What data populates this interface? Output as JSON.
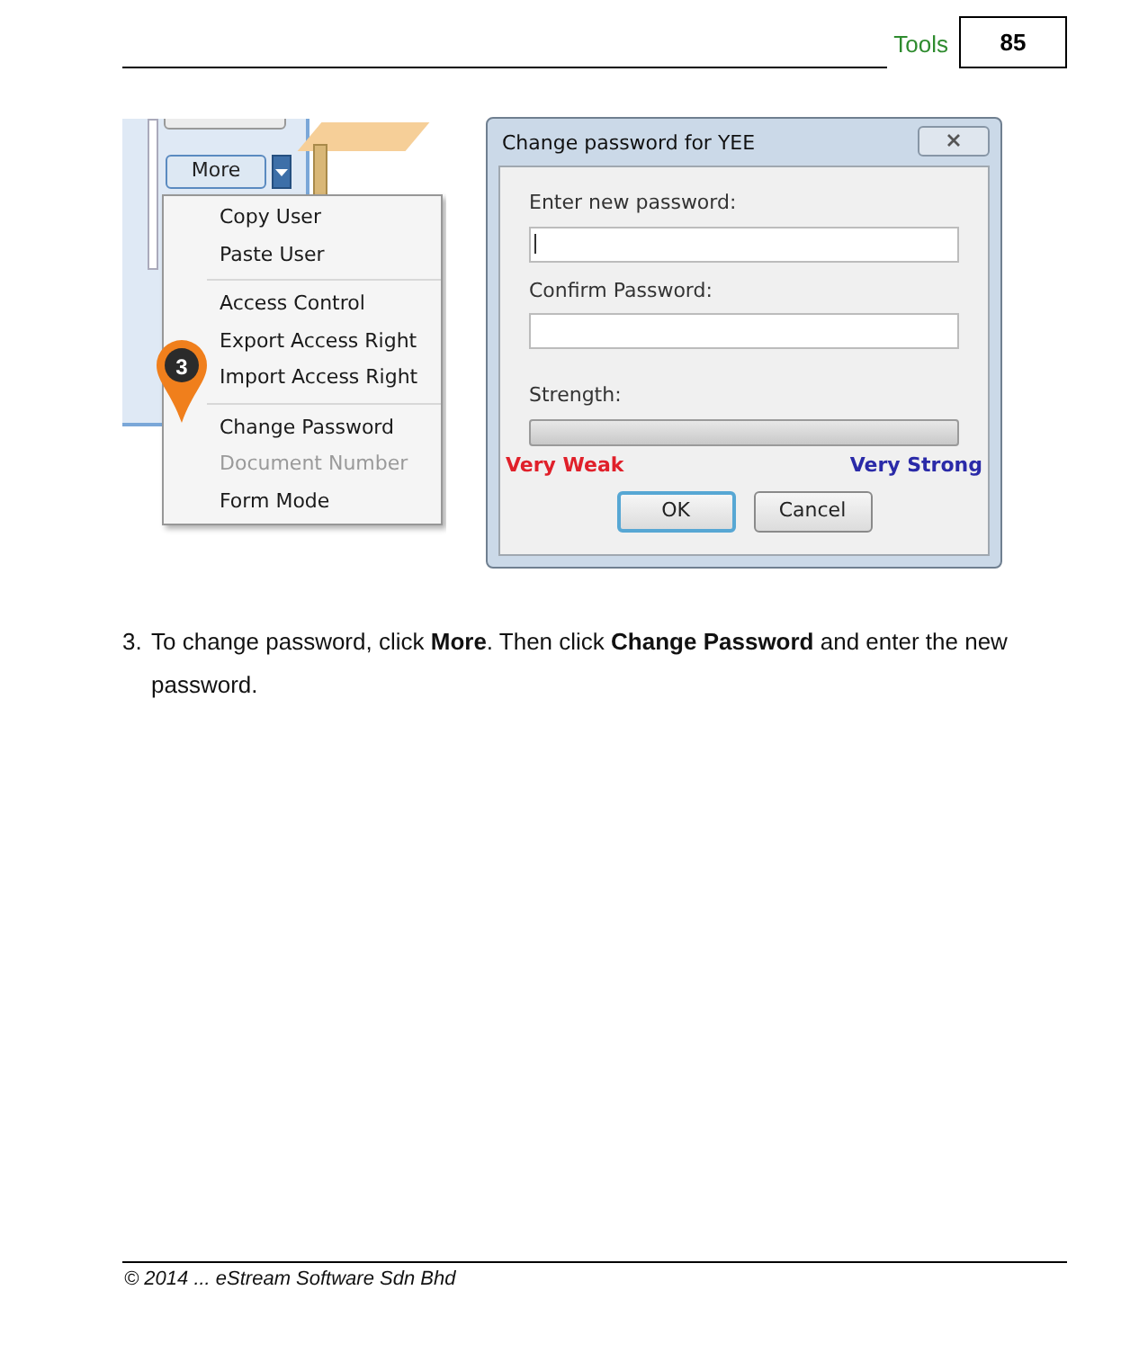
{
  "header": {
    "section": "Tools",
    "page_number": "85"
  },
  "menu_screenshot": {
    "more_button": "More",
    "callout": "3",
    "menu_groups": [
      [
        {
          "label": "Copy User",
          "disabled": false
        },
        {
          "label": "Paste User",
          "disabled": false
        }
      ],
      [
        {
          "label": "Access Control",
          "disabled": false
        },
        {
          "label": "Export Access Right",
          "disabled": false
        },
        {
          "label": "Import Access Right",
          "disabled": false
        }
      ],
      [
        {
          "label": "Change Password",
          "disabled": false
        },
        {
          "label": "Document Number",
          "disabled": true
        },
        {
          "label": "Form Mode",
          "disabled": false
        }
      ]
    ]
  },
  "dialog": {
    "title": "Change password for YEE",
    "new_password_label": "Enter new password:",
    "confirm_label": "Confirm Password:",
    "strength_label": "Strength:",
    "strength": {
      "level": 0
    },
    "weak_label": "Very Weak",
    "strong_label": "Very Strong",
    "buttons": [
      {
        "label": "OK",
        "default": true
      },
      {
        "label": "Cancel",
        "default": false
      }
    ]
  },
  "step": {
    "number": "3.",
    "text": "To change password, click **More**. Then click **Change Password** and enter the new password."
  },
  "footer": "© 2014 ... eStream Software Sdn Bhd"
}
